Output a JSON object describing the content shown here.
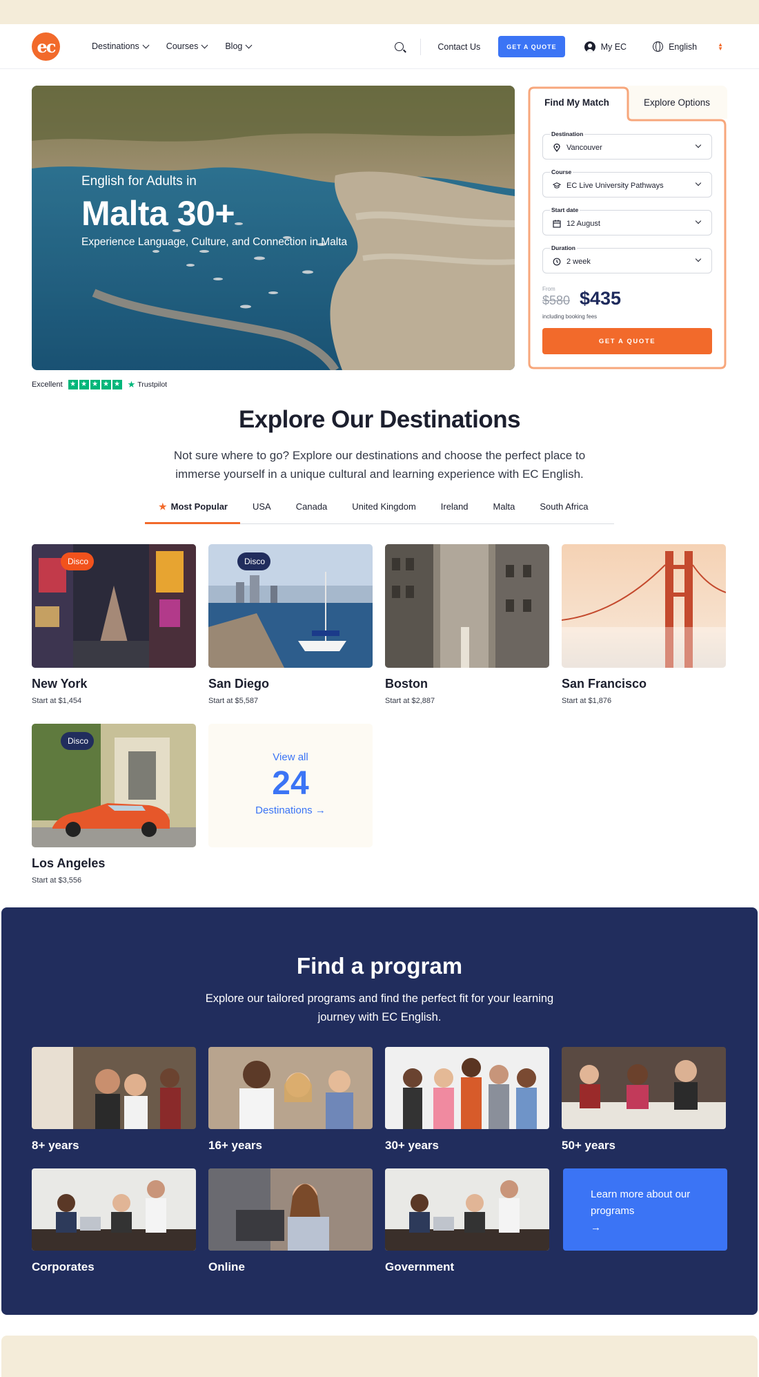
{
  "nav": {
    "logo_text": "ec",
    "menu": [
      {
        "label": "Destinations"
      },
      {
        "label": "Courses"
      },
      {
        "label": "Blog"
      }
    ],
    "contact": "Contact Us",
    "quote_button": "GET A QUOTE",
    "account": "My EC",
    "language": "English"
  },
  "hero": {
    "subtitle": "English for Adults in",
    "title": "Malta 30+",
    "tagline": "Experience Language, Culture, and Connection in Malta"
  },
  "trustpilot": {
    "rating_text": "Excellent",
    "stars": 5,
    "brand": "Trustpilot"
  },
  "match": {
    "tab_active": "Find My Match",
    "tab_other": "Explore Options",
    "fields": [
      {
        "label": "Destination",
        "value": "Vancouver",
        "icon": "map-pin-icon"
      },
      {
        "label": "Course",
        "value": "EC Live University Pathways",
        "icon": "graduation-cap-icon"
      },
      {
        "label": "Start date",
        "value": "12 August",
        "icon": "calendar-icon"
      },
      {
        "label": "Duration",
        "value": "2 week",
        "icon": "clock-icon"
      }
    ],
    "price_from_label": "From",
    "price_old": "$580",
    "price_new": "$435",
    "price_note": "including booking fees",
    "button": "GET A QUOTE"
  },
  "destinations": {
    "title": "Explore Our Destinations",
    "description": "Not sure where to go? Explore our destinations and choose the perfect place to immerse yourself in a unique cultural and learning experience with EC English.",
    "tabs": [
      "Most Popular",
      "USA",
      "Canada",
      "United Kingdom",
      "Ireland",
      "Malta",
      "South Africa"
    ],
    "cards": [
      {
        "name": "New York",
        "price": "Start at $1,454",
        "badge": "Disco",
        "badge_color": "#f2521c"
      },
      {
        "name": "San Diego",
        "price": "Start at $5,587",
        "badge": "Disco",
        "badge_color": "#212d5d"
      },
      {
        "name": "Boston",
        "price": "Start at $2,887"
      },
      {
        "name": "San Francisco",
        "price": "Start at $1,876"
      },
      {
        "name": "Los Angeles",
        "price": "Start at $3,556",
        "badge": "Disco",
        "badge_color": "#212d5d"
      }
    ],
    "view_all": {
      "line1": "View all",
      "count": "24",
      "line3": "Destinations"
    }
  },
  "programs": {
    "title": "Find a program",
    "description": "Explore our tailored programs and find the perfect fit for your learning journey with EC English.",
    "cards": [
      "8+ years",
      "16+ years",
      "30+ years",
      "50+ years",
      "Corporates",
      "Online",
      "Government"
    ],
    "learn_more": "Learn more about our programs"
  },
  "colors": {
    "brand_orange": "#f26a2b",
    "accent_blue": "#3b74f5",
    "navy": "#212d5d",
    "cream": "#f4ecd9"
  }
}
